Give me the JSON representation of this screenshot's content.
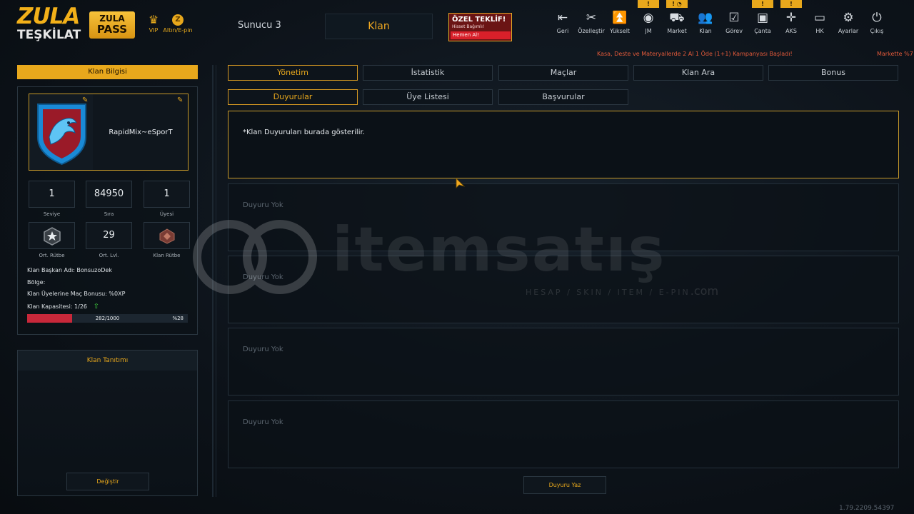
{
  "logo": {
    "line1": "ZULA",
    "line2": "TEŞKİLAT"
  },
  "pass": {
    "line1": "ZULA",
    "line2": "PASS"
  },
  "vip_label": "VIP",
  "altin_label": "Altın/E-pin",
  "server": "Sunucu 3",
  "active_section": "Klan",
  "offer": {
    "title": "ÖZEL TEKLİF!",
    "subtitle": "Hisset Bağımlı!",
    "cta": "Hemen Al!"
  },
  "nav": [
    {
      "label": "Geri",
      "icon": "exit-icon",
      "glyph": "⎋"
    },
    {
      "label": "Özelleştir",
      "icon": "tools-icon",
      "glyph": "✂"
    },
    {
      "label": "Yükselt",
      "icon": "upgrade-icon",
      "glyph": "⏶"
    },
    {
      "label": "JM",
      "icon": "coins-icon",
      "glyph": "◍",
      "badge": "!"
    },
    {
      "label": "Market",
      "icon": "cart-icon",
      "glyph": "🛒",
      "badge": "! ◔"
    },
    {
      "label": "Klan",
      "icon": "clan-icon",
      "glyph": "👥"
    },
    {
      "label": "Görev",
      "icon": "task-icon",
      "glyph": "☑"
    },
    {
      "label": "Çanta",
      "icon": "bag-icon",
      "glyph": "▣",
      "badge": "!"
    },
    {
      "label": "AKS",
      "icon": "crosshair-icon",
      "glyph": "✛",
      "badge": "!"
    },
    {
      "label": "HK",
      "icon": "wallet-icon",
      "glyph": "▭"
    },
    {
      "label": "Ayarlar",
      "icon": "gear-icon",
      "glyph": "⚙"
    },
    {
      "label": "Çıkış",
      "icon": "power-icon",
      "glyph": "⏻"
    }
  ],
  "ticker": "Kasa, Deste ve Materyallerde 2 Al 1 Öde (1+1) Kampanyası Başladı!",
  "ticker2": "Markette %7",
  "left": {
    "header": "Klan Bilgisi",
    "clan_name": "RapidMix~eSporT",
    "stats": [
      {
        "value": "1",
        "label": "Seviye"
      },
      {
        "value": "84950",
        "label": "Sıra"
      },
      {
        "value": "1",
        "label": "Üyesi"
      }
    ],
    "stats2": [
      {
        "label": "Ort. Rütbe"
      },
      {
        "value": "29",
        "label": "Ort. Lvl."
      },
      {
        "label": "Klan Rütbe"
      }
    ],
    "info": {
      "leader": "Klan Başkan Adı:  BonsuzoDek",
      "region": "Bölge:",
      "bonus": "Klan Üyelerine Maç Bonusu:  %0XP",
      "capacity": "Klan Kapasitesi: 1/26"
    },
    "progress": {
      "value": 282,
      "max": 1000,
      "text": "282/1000",
      "pct": "%28"
    },
    "tanitim_header": "Klan Tanıtımı",
    "change_button": "Değiştir"
  },
  "tabs_top": [
    {
      "label": "Yönetim",
      "active": true
    },
    {
      "label": "İstatistik",
      "active": false
    },
    {
      "label": "Maçlar",
      "active": false
    },
    {
      "label": "Klan Ara",
      "active": false
    },
    {
      "label": "Bonus",
      "active": false
    }
  ],
  "tabs_sub": [
    {
      "label": "Duyurular",
      "active": true
    },
    {
      "label": "Üye Listesi",
      "active": false
    },
    {
      "label": "Başvurular",
      "active": false
    }
  ],
  "announce_main": "*Klan Duyuruları burada gösterilir.",
  "announcements": [
    "Duyuru Yok",
    "Duyuru Yok",
    "Duyuru Yok",
    "Duyuru Yok"
  ],
  "write_button": "Duyuru Yaz",
  "version": "1.79.2209.54397",
  "watermark": {
    "main": "itemsatış",
    "sub": "HESAP / SKIN / ITEM / E-PIN",
    "dotcom": ".com"
  },
  "colors": {
    "accent": "#e8a81c",
    "danger": "#c8283a",
    "bg": "#0d131a"
  }
}
